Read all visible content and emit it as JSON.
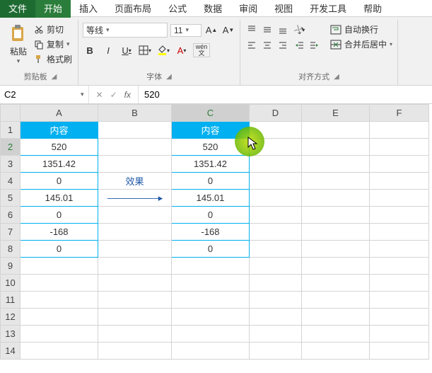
{
  "tabs": {
    "file": "文件",
    "home": "开始",
    "insert": "插入",
    "layout": "页面布局",
    "formula": "公式",
    "data": "数据",
    "review": "审阅",
    "view": "视图",
    "dev": "开发工具",
    "help": "帮助"
  },
  "clipboard": {
    "paste": "粘贴",
    "cut": "剪切",
    "copy": "复制",
    "painter": "格式刷",
    "label": "剪贴板"
  },
  "font": {
    "name": "等线",
    "size": "11",
    "label": "字体",
    "wen": "wén"
  },
  "align": {
    "label": "对齐方式",
    "wrap": "自动换行",
    "merge": "合并后居中"
  },
  "namebox": "C2",
  "formula": "520",
  "arrow_label": "效果",
  "cols": [
    "A",
    "B",
    "C",
    "D",
    "E",
    "F"
  ],
  "rows": [
    "1",
    "2",
    "3",
    "4",
    "5",
    "6",
    "7",
    "8",
    "9",
    "10",
    "11",
    "12",
    "13",
    "14"
  ],
  "tableA": {
    "header": "内容",
    "values": [
      "520",
      "1351.42",
      "0",
      "145.01",
      "0",
      "-168",
      "0"
    ]
  },
  "tableC": {
    "header": "内容",
    "values": [
      "520",
      "1351.42",
      "0",
      "145.01",
      "0",
      "-168",
      "0"
    ]
  }
}
